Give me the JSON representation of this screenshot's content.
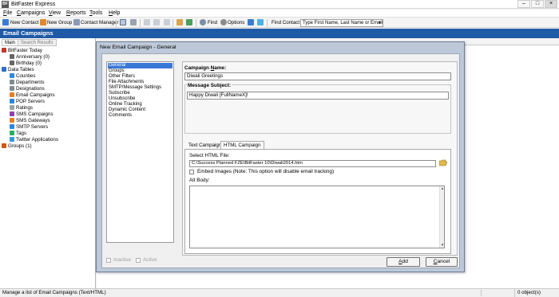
{
  "window": {
    "title": "BitFaster Express",
    "app_icon": "BF"
  },
  "menubar": {
    "items": [
      {
        "label": "File",
        "accel": "F",
        "rest": "ile"
      },
      {
        "label": "Campaigns",
        "accel": "C",
        "rest": "ampaigns"
      },
      {
        "label": "View",
        "accel": "V",
        "rest": "iew"
      },
      {
        "label": "Reports",
        "accel": "R",
        "rest": "eports"
      },
      {
        "label": "Tools",
        "accel": "T",
        "rest": "ools"
      },
      {
        "label": "Help",
        "accel": "H",
        "rest": "elp"
      }
    ]
  },
  "toolbar": {
    "new_contact": "New Contact",
    "new_group": "New Group",
    "contact_manager": "Contact Manager",
    "find": "Find",
    "options": "Options",
    "find_contact_label": "Find Contact",
    "find_contact_value": "Type First Name, Last Name or Email"
  },
  "section_header": "Email Campaigns",
  "left_panel": {
    "tabs": [
      "Main",
      "Search Results"
    ],
    "tree": [
      {
        "label": "BitFaster Today",
        "level": 0,
        "icon_color": "#c0392b"
      },
      {
        "label": "Anniversary (0)",
        "level": 1,
        "icon_color": "#666666"
      },
      {
        "label": "Birthday (0)",
        "level": 1,
        "icon_color": "#666666"
      },
      {
        "label": "Data Tables",
        "level": 0,
        "icon_color": "#2e6fc9"
      },
      {
        "label": "Counties",
        "level": 1,
        "icon_color": "#2e86de"
      },
      {
        "label": "Departments",
        "level": 1,
        "icon_color": "#7f8c8d"
      },
      {
        "label": "Designations",
        "level": 1,
        "icon_color": "#7f8c8d"
      },
      {
        "label": "Email Campaigns",
        "level": 1,
        "icon_color": "#e67e22"
      },
      {
        "label": "POP Servers",
        "level": 1,
        "icon_color": "#2e86de"
      },
      {
        "label": "Ratings",
        "level": 1,
        "icon_color": "#95a5a6"
      },
      {
        "label": "SMS Campaigns",
        "level": 1,
        "icon_color": "#8e44ad"
      },
      {
        "label": "SMS Gateways",
        "level": 1,
        "icon_color": "#e67e22"
      },
      {
        "label": "SMTP Servers",
        "level": 1,
        "icon_color": "#2e86de"
      },
      {
        "label": "Tags",
        "level": 1,
        "icon_color": "#27ae60"
      },
      {
        "label": "Twitter Applications",
        "level": 1,
        "icon_color": "#3498db"
      },
      {
        "label": "Groups (1)",
        "level": 0,
        "icon_color": "#d35400"
      }
    ]
  },
  "status_bar": {
    "message": "Manage a list of Email Campaigns (Text/HTML)",
    "count": "0 object(s)"
  },
  "dialog": {
    "title": "New Email Campaign - General",
    "nav": [
      {
        "label": "General",
        "selected": true
      },
      {
        "label": "Groups",
        "selected": false
      },
      {
        "label": "Other Filters",
        "selected": false
      },
      {
        "label": "File Attachments",
        "selected": false
      },
      {
        "label": "SMTP/Message Settings",
        "selected": false
      },
      {
        "label": "Subscribe",
        "selected": false
      },
      {
        "label": "Unsubscribe",
        "selected": false
      },
      {
        "label": "Online Tracking",
        "selected": false
      },
      {
        "label": "Dynamic Content",
        "selected": false
      },
      {
        "label": "Comments",
        "selected": false
      }
    ],
    "campaign_name_label_pre": "Campaign ",
    "campaign_name_label_accel": "N",
    "campaign_name_label_post": "ame:",
    "campaign_name_value": "Diwali Greetings",
    "message_subject_label": "Message Subject:",
    "message_subject_value": "Happy Diwali [FullNameX]!",
    "tabs": [
      "Text Campaign",
      "HTML Campaign"
    ],
    "active_tab": "HTML Campaign",
    "select_html_label": "Select HTML File:",
    "html_file_value": "C:\\Success Planned FZE\\BitFaster 10\\Diwali2014.htm",
    "embed_images_label": "Embed Images (Note: This option will disable email tracking)",
    "embed_images_checked": false,
    "alt_body_label": "Alt Body:",
    "alt_body_value": "",
    "inactive_label": "Inactive",
    "active_label": "Active",
    "add_button_pre": "",
    "add_button_accel": "A",
    "add_button_post": "dd",
    "cancel_button_pre": "",
    "cancel_button_accel": "C",
    "cancel_button_post": "ancel"
  },
  "colors": {
    "section_header": "#1f5aa6",
    "dialog_frame": "#bdc9d8",
    "nav_selected": "#3a78d8"
  }
}
